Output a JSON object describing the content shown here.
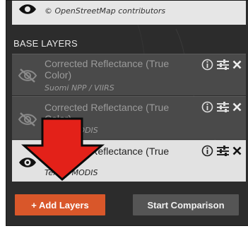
{
  "attribution": {
    "text": "© OpenStreetMap contributors"
  },
  "base_layers": {
    "header": "BASE LAYERS",
    "items": [
      {
        "title": "Corrected Reflectance (True Color)",
        "subtitle": "Suomi NPP / VIIRS",
        "visible": false
      },
      {
        "title": "Corrected Reflectance (True Color)",
        "subtitle": "Aqua / MODIS",
        "visible": false
      },
      {
        "title": "Corrected Reflectance (True Color)",
        "subtitle": "Terra / MODIS",
        "visible": true
      }
    ]
  },
  "footer": {
    "add_layers_label": "+ Add Layers",
    "start_comparison_label": "Start Comparison"
  },
  "colors": {
    "panel_bg": "#2c2c2c",
    "layer_bg": "#4a4a4a",
    "active_layer_bg": "#e2e2e2",
    "add_button": "#d9572a",
    "compare_button": "#555555",
    "annotation_arrow": "#e32119"
  },
  "icons": {
    "visibility_on": "eye-icon",
    "visibility_off": "eye-slash-icon",
    "info": "info-icon",
    "options": "sliders-icon",
    "remove": "close-icon",
    "annotation": "red-down-arrow"
  }
}
